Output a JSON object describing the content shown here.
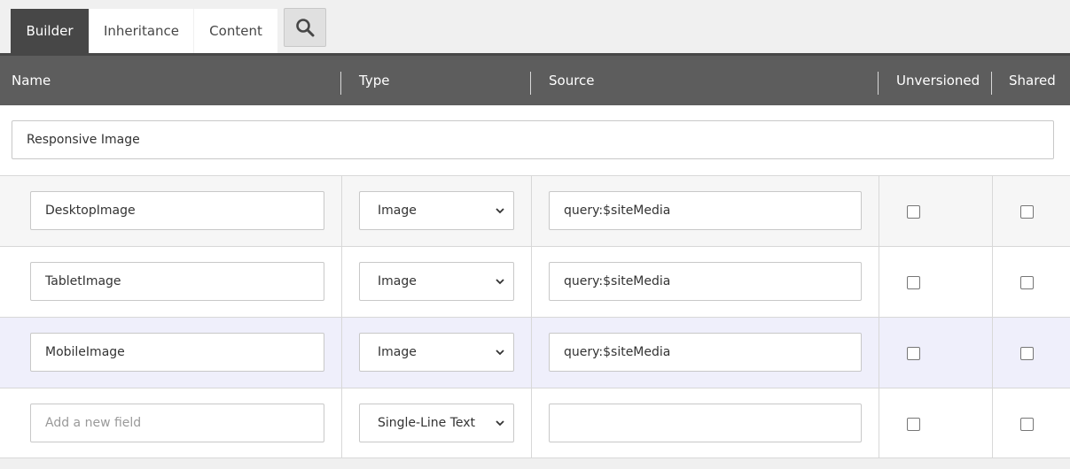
{
  "tabs": [
    {
      "label": "Builder",
      "active": true
    },
    {
      "label": "Inheritance",
      "active": false
    },
    {
      "label": "Content",
      "active": false
    }
  ],
  "search_button": {
    "icon": "search-icon"
  },
  "columns": {
    "name": "Name",
    "type": "Type",
    "source": "Source",
    "unversioned": "Unversioned",
    "shared": "Shared"
  },
  "section": {
    "value": "Responsive Image"
  },
  "fields": [
    {
      "name": "DesktopImage",
      "type": "Image",
      "source": "query:$siteMedia",
      "unversioned": false,
      "shared": false
    },
    {
      "name": "TabletImage",
      "type": "Image",
      "source": "query:$siteMedia",
      "unversioned": false,
      "shared": false
    },
    {
      "name": "MobileImage",
      "type": "Image",
      "source": "query:$siteMedia",
      "unversioned": false,
      "shared": false
    }
  ],
  "new_field": {
    "placeholder": "Add a new field",
    "type": "Single-Line Text",
    "source": "",
    "unversioned": false,
    "shared": false
  },
  "colors": {
    "tab_active": "#474747",
    "header_bg": "#5d5d5d",
    "row_shaded": "#f6f6f6",
    "row_selected": "#efeffb"
  }
}
